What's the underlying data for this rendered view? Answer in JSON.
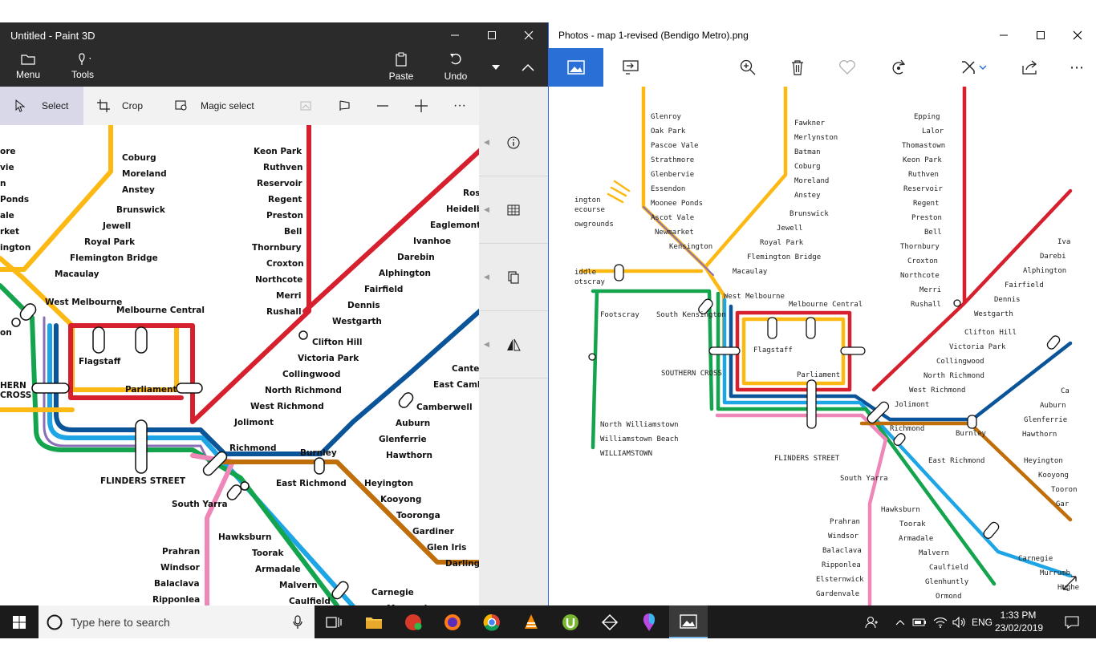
{
  "paint3d": {
    "title": "Untitled - Paint 3D",
    "menu_label": "Menu",
    "tools_label": "Tools",
    "paste_label": "Paste",
    "undo_label": "Undo",
    "select_label": "Select",
    "crop_label": "Crop",
    "magic_select_label": "Magic select",
    "more": "···"
  },
  "photos": {
    "title": "Photos - map 1-revised (Bendigo Metro).png"
  },
  "taskbar": {
    "search_placeholder": "Type here to search",
    "language": "ENG",
    "time": "1:33 PM",
    "date": "23/02/2019"
  },
  "map_left": {
    "labels": [
      "Coburg",
      "Moreland",
      "Anstey",
      "Brunswick",
      "Jewell",
      "Royal Park",
      "Flemington Bridge",
      "Macaulay",
      "West Melbourne",
      "Melbourne Central",
      "Flagstaff",
      "Parliament",
      "FLINDERS STREET",
      "Richmond",
      "Burnley",
      "East Richmond",
      "South Yarra",
      "Hawksburn",
      "Toorak",
      "Armadale",
      "Malvern",
      "Caulfield",
      "Glenhuntly",
      "Prahran",
      "Windsor",
      "Balaclava",
      "Ripponlea",
      "Elsternwick",
      "Keon Park",
      "Ruthven",
      "Reservoir",
      "Regent",
      "Preston",
      "Bell",
      "Thornbury",
      "Croxton",
      "Northcote",
      "Merri",
      "Rushall",
      "Clifton Hill",
      "Victoria Park",
      "Collingwood",
      "North Richmond",
      "West Richmond",
      "Jolimont",
      "Westgarth",
      "Dennis",
      "Fairfield",
      "Alphington",
      "Darebin",
      "Ivanhoe",
      "Eaglemont",
      "Heidelb",
      "Ros",
      "Camberwell",
      "East Camb",
      "Cante",
      "Auburn",
      "Glenferrie",
      "Hawthorn",
      "Heyington",
      "Kooyong",
      "Tooronga",
      "Gardiner",
      "Glen Iris",
      "Darling",
      "Carnegie",
      "Murrumbeena",
      "Hughesdale",
      "ore",
      "vie",
      "n",
      "Ponds",
      "ale",
      "rket",
      "ington",
      "on",
      "HERN",
      "CROSS"
    ]
  },
  "map_right": {
    "labels": [
      "Glenroy",
      "Oak Park",
      "Pascoe Vale",
      "Strathmore",
      "Glenbervie",
      "Essendon",
      "Moonee Ponds",
      "Ascot Vale",
      "Newmarket",
      "Kensington",
      "Fawkner",
      "Merlynston",
      "Batman",
      "Coburg",
      "Moreland",
      "Anstey",
      "Brunswick",
      "Jewell",
      "Royal Park",
      "Flemington Bridge",
      "Macaulay",
      "West Melbourne",
      "Melbourne Central",
      "Flagstaff",
      "Parliament",
      "SOUTHERN CROSS",
      "FLINDERS STREET",
      "Footscray",
      "South Kensington",
      "Epping",
      "Lalor",
      "Thomastown",
      "Keon Park",
      "Ruthven",
      "Reservoir",
      "Regent",
      "Preston",
      "Bell",
      "Thornbury",
      "Croxton",
      "Northcote",
      "Merri",
      "Rushall",
      "Westgarth",
      "Clifton Hill",
      "Victoria Park",
      "Collingwood",
      "North Richmond",
      "West Richmond",
      "Jolimont",
      "Dennis",
      "Fairfield",
      "Alphington",
      "Darebi",
      "Iva",
      "Richmond",
      "Burnley",
      "East Richmond",
      "South Yarra",
      "Hawksburn",
      "Toorak",
      "Armadale",
      "Malvern",
      "Caulfield",
      "Glenhuntly",
      "Ormond",
      "Prahran",
      "Windsor",
      "Balaclava",
      "Ripponlea",
      "Elsternwick",
      "Gardenvale",
      "Heyington",
      "Kooyong",
      "Tooron",
      "Gar",
      "Carnegie",
      "Murrumb",
      "Hughe",
      "Auburn",
      "Glenferrie",
      "Hawthorn",
      "Ca",
      "North Williamstown",
      "Williamstown Beach",
      "WILLIAMSTOWN",
      "ington",
      "ecourse",
      "owgrounds",
      "iddle",
      "otscray"
    ]
  },
  "colors": {
    "line_yellow": "#fdb913",
    "line_red": "#d7202e",
    "line_blue": "#0a5499",
    "line_lightblue": "#1ea5e6",
    "line_green": "#14a44d",
    "line_pink": "#ee86b8",
    "line_brown": "#c06e09",
    "line_purple": "#8a6fb8",
    "accent": "#2a6fd6"
  }
}
